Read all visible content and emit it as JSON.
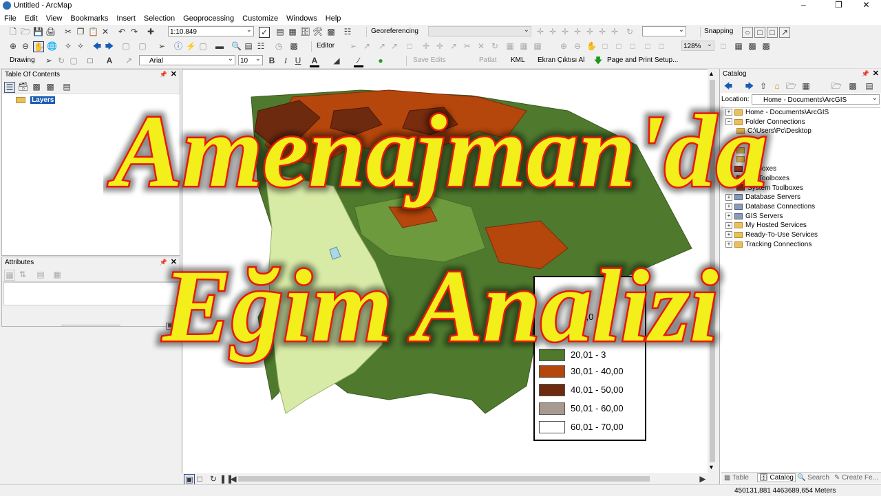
{
  "window": {
    "title": "Untitled - ArcMap"
  },
  "menu": [
    "File",
    "Edit",
    "View",
    "Bookmarks",
    "Insert",
    "Selection",
    "Geoprocessing",
    "Customize",
    "Windows",
    "Help"
  ],
  "toolbar1": {
    "scale": "1:10.849",
    "georeferencing": "Georeferencing",
    "snapping": "Snapping"
  },
  "toolbar2": {
    "editor": "Editor",
    "zoom": "128%"
  },
  "toolbar3": {
    "drawing": "Drawing",
    "font": "Arial",
    "font_size": "10",
    "bold": "B",
    "italic": "I",
    "underline": "U",
    "save_edits": "Save Edits",
    "patlat": "Patlat",
    "kml": "KML",
    "ekran": "Ekran Çıktısı Al",
    "page_print": "Page and Print Setup..."
  },
  "toc": {
    "title": "Table Of Contents",
    "layers": "Layers"
  },
  "attributes": {
    "title": "Attributes"
  },
  "catalog": {
    "title": "Catalog",
    "location_label": "Location:",
    "location_value": "Home - Documents\\ArcGIS",
    "items": [
      {
        "label": "Home - Documents\\ArcGIS",
        "type": "folder",
        "level": 0
      },
      {
        "label": "Folder Connections",
        "type": "folder",
        "level": 0
      },
      {
        "label": "C:\\Users\\Pc\\Desktop",
        "type": "folder",
        "level": 1
      },
      {
        "label": "D:\\",
        "type": "folder",
        "level": 1
      },
      {
        "label": "E:\\",
        "type": "folder",
        "level": 1
      },
      {
        "label": "F:\\",
        "type": "folder",
        "level": 1
      },
      {
        "label": "Toolboxes",
        "type": "tbx",
        "level": 0
      },
      {
        "label": "My Toolboxes",
        "type": "tbx",
        "level": 1
      },
      {
        "label": "System Toolboxes",
        "type": "tbx",
        "level": 1
      },
      {
        "label": "Database Servers",
        "type": "db",
        "level": 0
      },
      {
        "label": "Database Connections",
        "type": "db",
        "level": 0
      },
      {
        "label": "GIS Servers",
        "type": "db",
        "level": 0
      },
      {
        "label": "My Hosted Services",
        "type": "folder",
        "level": 0
      },
      {
        "label": "Ready-To-Use Services",
        "type": "folder",
        "level": 0
      },
      {
        "label": "Tracking Connections",
        "type": "folder",
        "level": 0
      }
    ],
    "tabs": [
      "Table",
      "Catalog",
      "Search",
      "Create Fe..."
    ]
  },
  "legend": {
    "partial_1": "09,0",
    "partial_2": "20,01 - 3",
    "classes": [
      {
        "label": "30,01 - 40,00",
        "color": "#b5460c"
      },
      {
        "label": "40,01 - 50,00",
        "color": "#6e2a0f"
      },
      {
        "label": "50,01 - 60,00",
        "color": "#a89a8f"
      },
      {
        "label": "60,01 - 70,00",
        "color": "#ffffff"
      }
    ],
    "hidden_color": "#4f7a2e"
  },
  "overlay": {
    "line1": "Amenajman'da",
    "line2": "Eğim Analizi",
    "fill": "#f2ef1a",
    "stroke": "#e8180c"
  },
  "status": {
    "coords": "450131,881  4463689,654 Meters"
  },
  "colors": {
    "dark_green": "#4f7a2e",
    "mid_green": "#6d9a3c",
    "light_green": "#d7eaa6",
    "orange": "#c2510d",
    "brown": "#7a2c0e"
  }
}
